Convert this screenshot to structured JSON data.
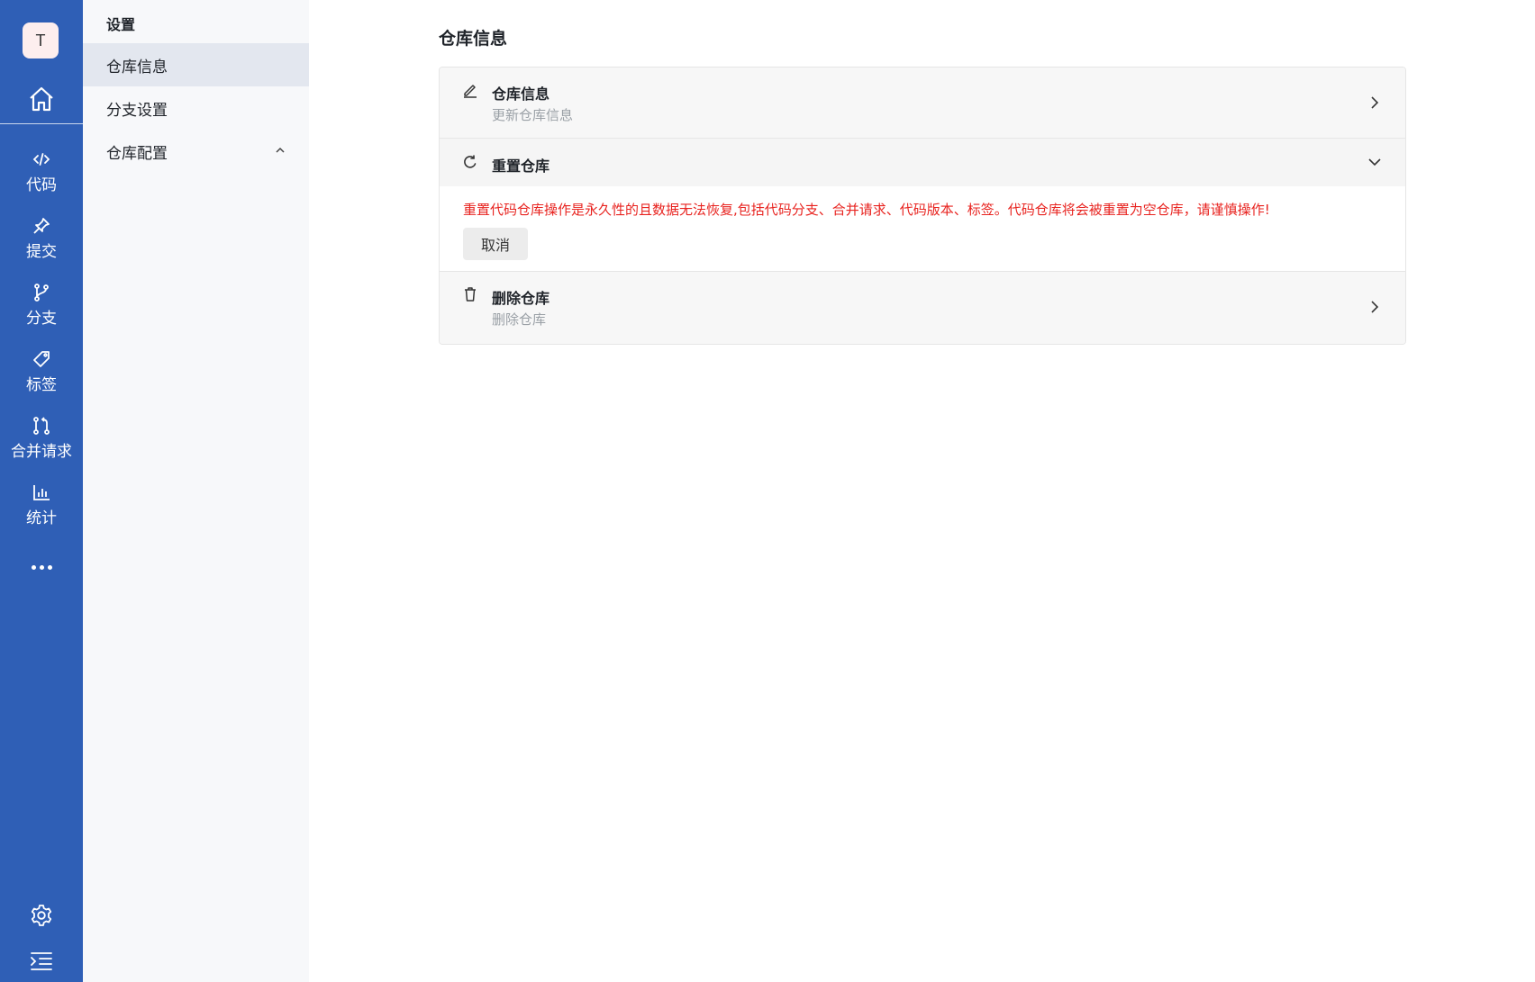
{
  "rail": {
    "avatar_letter": "T",
    "items": [
      {
        "label": "代码",
        "icon": "code-icon"
      },
      {
        "label": "提交",
        "icon": "pin-icon"
      },
      {
        "label": "分支",
        "icon": "branch-icon"
      },
      {
        "label": "标签",
        "icon": "tag-icon"
      },
      {
        "label": "合并请求",
        "icon": "merge-request-icon"
      },
      {
        "label": "统计",
        "icon": "bar-chart-icon"
      }
    ],
    "accent": "#2f5fb6"
  },
  "sidebar": {
    "title": "设置",
    "items": [
      {
        "label": "仓库信息",
        "active": true
      },
      {
        "label": "分支设置"
      },
      {
        "label": "仓库配置",
        "expanded": true
      }
    ]
  },
  "main": {
    "title": "仓库信息",
    "sections": [
      {
        "title": "仓库信息",
        "subtitle": "更新仓库信息",
        "icon": "edit-icon"
      },
      {
        "title": "重置仓库",
        "icon": "reset-icon",
        "warning": "重置代码仓库操作是永久性的且数据无法恢复,包括代码分支、合并请求、代码版本、标签。代码仓库将会被重置为空仓库，请谨慎操作!",
        "cancel_label": "取消"
      },
      {
        "title": "删除仓库",
        "subtitle": "删除仓库",
        "icon": "trash-icon"
      }
    ],
    "warning_color": "#e8231f"
  }
}
